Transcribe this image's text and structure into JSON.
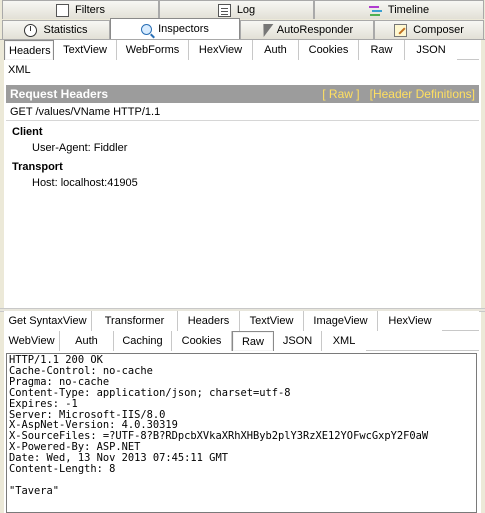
{
  "top_tabs": {
    "row1": [
      {
        "label": "Filters",
        "icon": "filters-icon"
      },
      {
        "label": "Log",
        "icon": "log-icon"
      },
      {
        "label": "Timeline",
        "icon": "timeline-icon"
      }
    ],
    "row2": [
      {
        "label": "Statistics",
        "icon": "statistics-icon"
      },
      {
        "label": "Inspectors",
        "icon": "inspectors-icon",
        "active": true
      },
      {
        "label": "AutoResponder",
        "icon": "autoresponder-icon"
      },
      {
        "label": "Composer",
        "icon": "composer-icon"
      }
    ]
  },
  "request_tabs": {
    "row1": [
      "Headers",
      "TextView",
      "WebForms",
      "HexView",
      "Auth",
      "Cookies",
      "Raw",
      "JSON"
    ],
    "row2": [
      "XML"
    ],
    "active": "Headers"
  },
  "request_headers": {
    "title": "Request Headers",
    "raw_link": "[ Raw ]",
    "definitions_link": "[Header Definitions]",
    "request_line": "GET /values/VName HTTP/1.1",
    "sections": [
      {
        "name": "Client",
        "items": [
          "User-Agent: Fiddler"
        ]
      },
      {
        "name": "Transport",
        "items": [
          "Host: localhost:41905"
        ]
      }
    ]
  },
  "response_tabs": {
    "row1": [
      "Get SyntaxView",
      "Transformer",
      "Headers",
      "TextView",
      "ImageView",
      "HexView"
    ],
    "row2": [
      "WebView",
      "Auth",
      "Caching",
      "Cookies",
      "Raw",
      "JSON",
      "XML"
    ],
    "active": "Raw"
  },
  "response_raw": "HTTP/1.1 200 OK\nCache-Control: no-cache\nPragma: no-cache\nContent-Type: application/json; charset=utf-8\nExpires: -1\nServer: Microsoft-IIS/8.0\nX-AspNet-Version: 4.0.30319\nX-SourceFiles: =?UTF-8?B?RDpcbXVkaXRhXHByb2plY3RzXE12YOFwcGxpY2F0aW\nX-Powered-By: ASP.NET\nDate: Wed, 13 Nov 2013 07:45:11 GMT\nContent-Length: 8\n\n\"Tavera\""
}
